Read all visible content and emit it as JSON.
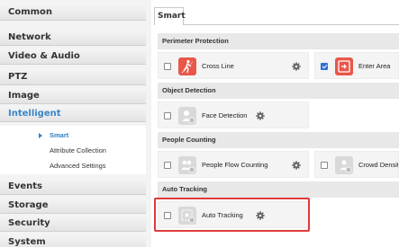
{
  "sidebar": {
    "items": [
      {
        "label": "Common"
      },
      {
        "label": "Network"
      },
      {
        "label": "Video & Audio"
      },
      {
        "label": "PTZ"
      },
      {
        "label": "Image"
      },
      {
        "label": "Intelligent"
      },
      {
        "label": "Events"
      },
      {
        "label": "Storage"
      },
      {
        "label": "Security"
      },
      {
        "label": "System"
      }
    ],
    "active_item": "Intelligent",
    "submenu": [
      {
        "label": "Smart"
      },
      {
        "label": "Attribute Collection"
      },
      {
        "label": "Advanced Settings"
      }
    ],
    "active_submenu": "Smart"
  },
  "tabs": [
    {
      "label": "Smart"
    }
  ],
  "sections": [
    {
      "title": "Perimeter Protection",
      "features": [
        {
          "label": "Cross Line",
          "checked": false,
          "icon": "cross-line-icon"
        },
        {
          "label": "Enter Area",
          "checked": true,
          "icon": "enter-area-icon"
        }
      ]
    },
    {
      "title": "Object Detection",
      "features": [
        {
          "label": "Face Detection",
          "checked": false,
          "icon": "face-detection-icon"
        }
      ]
    },
    {
      "title": "People Counting",
      "features": [
        {
          "label": "People Flow Counting",
          "checked": false,
          "icon": "people-flow-icon"
        },
        {
          "label": "Crowd Density",
          "checked": false,
          "icon": "crowd-density-icon"
        }
      ]
    },
    {
      "title": "Auto Tracking",
      "features": [
        {
          "label": "Auto Tracking",
          "checked": false,
          "icon": "auto-tracking-icon"
        }
      ]
    }
  ],
  "colors": {
    "accent": "#3a86c8",
    "active_icon": "#e8574a",
    "highlight": "#e03a3a",
    "checkbox_checked": "#2f6fd6"
  }
}
